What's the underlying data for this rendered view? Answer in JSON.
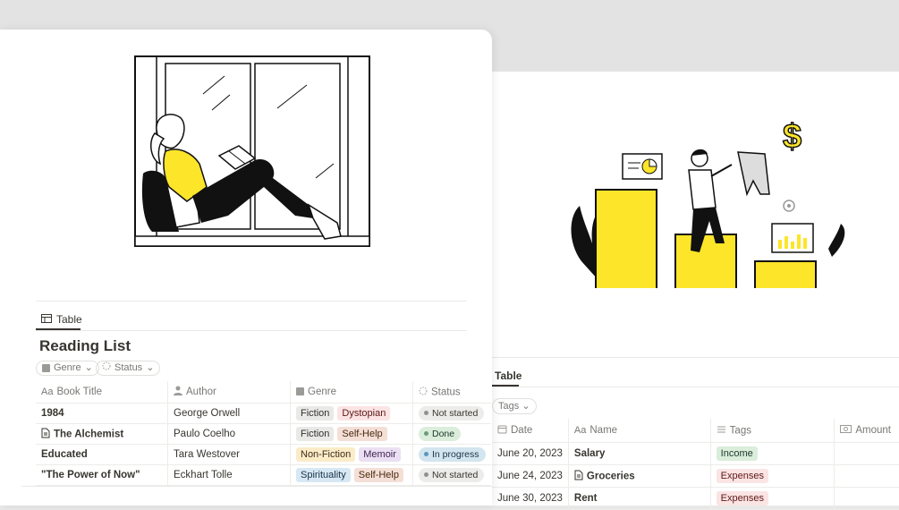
{
  "colors": {
    "accent_yellow": "#fde52a",
    "ink": "#111111",
    "fiction_bg": "#e9e9e7",
    "dystopian_bg": "#fbe4e4",
    "selfhelp_bg": "#f4dfd7",
    "nonfiction_bg": "#fbecc8",
    "memoir_bg": "#ebdff3",
    "spirituality_bg": "#d7e8f4",
    "notstarted_bg": "#ececea",
    "done_bg": "#dbeddb",
    "inprogress_bg": "#d3e5ef",
    "income_bg": "#dbeddb",
    "expenses_bg": "#fbe4e4"
  },
  "finance": {
    "tab_label": "Table",
    "filter_tags": "Tags",
    "columns": {
      "date": "Date",
      "name": "Name",
      "tags": "Tags",
      "amount": "Amount"
    },
    "rows": [
      {
        "date": "June 20, 2023",
        "name": "Salary",
        "tag": "Income",
        "has_doc_icon": false
      },
      {
        "date": "June 24, 2023",
        "name": "Groceries",
        "tag": "Expenses",
        "has_doc_icon": true
      },
      {
        "date": "June 30, 2023",
        "name": "Rent",
        "tag": "Expenses",
        "has_doc_icon": false
      }
    ],
    "dollar_sign": "$"
  },
  "reading": {
    "tab_label": "Table",
    "title": "Reading List",
    "filter_genre": "Genre",
    "filter_status": "Status",
    "columns": {
      "title": "Book Title",
      "author": "Author",
      "genre": "Genre",
      "status": "Status"
    },
    "rows": [
      {
        "title": "1984",
        "author": "George Orwell",
        "genres": [
          "Fiction",
          "Dystopian"
        ],
        "status": "Not started"
      },
      {
        "title": "The Alchemist",
        "author": "Paulo Coelho",
        "genres": [
          "Fiction",
          "Self-Help"
        ],
        "status": "Done"
      },
      {
        "title": "Educated",
        "author": "Tara Westover",
        "genres": [
          "Non-Fiction",
          "Memoir"
        ],
        "status": "In progress"
      },
      {
        "title": "\"The Power of Now\"",
        "author": "Eckhart Tolle",
        "genres": [
          "Spirituality",
          "Self-Help"
        ],
        "status": "Not started"
      }
    ]
  }
}
